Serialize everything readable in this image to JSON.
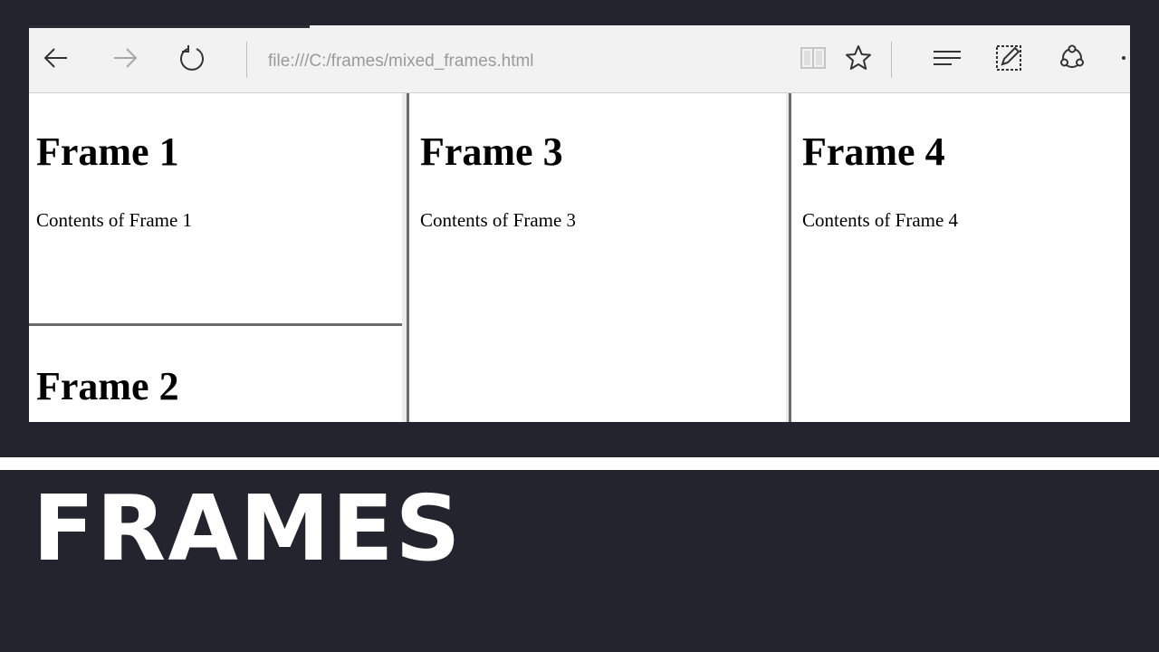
{
  "browser": {
    "address": "file:///C:/frames/mixed_frames.html",
    "icons": [
      "back-arrow-icon",
      "forward-arrow-icon",
      "refresh-icon",
      "reading-view-icon",
      "favorite-star-icon",
      "hub-icon",
      "web-note-icon",
      "share-icon",
      "more-icon"
    ]
  },
  "frames": [
    {
      "heading": "Frame 1",
      "content": "Contents of Frame 1"
    },
    {
      "heading": "Frame 2"
    },
    {
      "heading": "Frame 3",
      "content": "Contents of Frame 3"
    },
    {
      "heading": "Frame 4",
      "content": "Contents of Frame 4"
    }
  ],
  "caption": "FRAMES",
  "colors": {
    "background": "#22252e",
    "text": "#ffffff",
    "toolbar": "#f2f2f2"
  }
}
